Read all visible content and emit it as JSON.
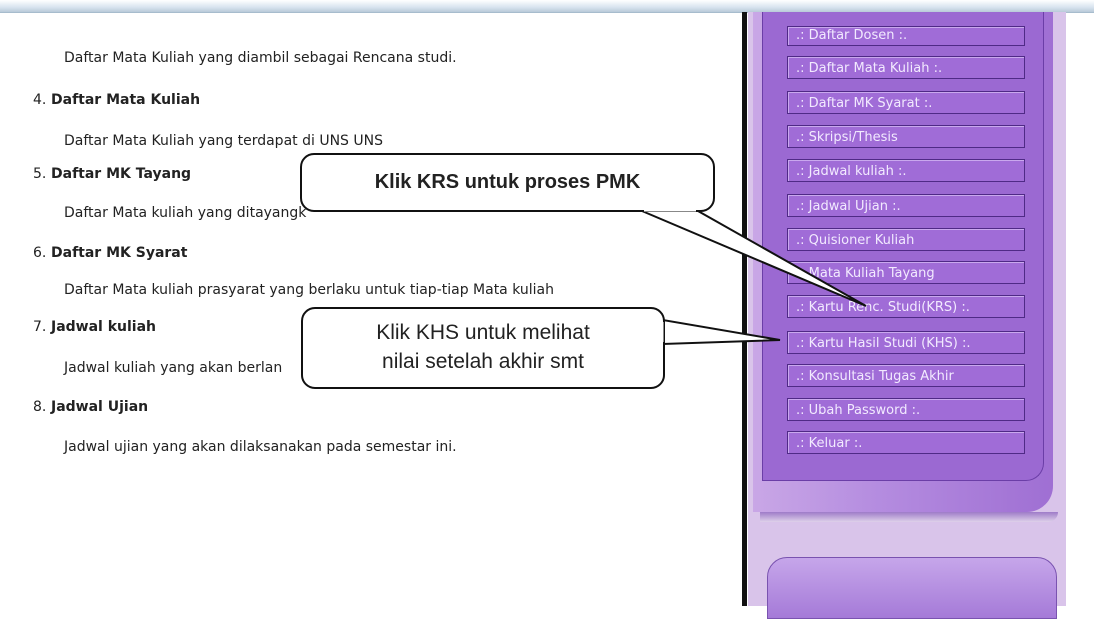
{
  "content": {
    "intro_desc": "Daftar Mata Kuliah yang diambil sebagai Rencana studi.",
    "items": [
      {
        "num": "4.",
        "title": "Daftar Mata Kuliah",
        "desc": "Daftar Mata Kuliah yang terdapat di UNS UNS"
      },
      {
        "num": "5.",
        "title": "Daftar MK Tayang",
        "desc": "Daftar Mata kuliah yang ditayangk"
      },
      {
        "num": "6.",
        "title": "Daftar MK Syarat",
        "desc": "Daftar Mata kuliah prasyarat yang berlaku untuk tiap-tiap Mata kuliah"
      },
      {
        "num": "7.",
        "title": "Jadwal kuliah",
        "desc": "Jadwal kuliah yang akan berlan"
      },
      {
        "num": "8.",
        "title": "Jadwal Ujian",
        "desc": "Jadwal ujian yang akan dilaksanakan pada semestar ini."
      }
    ]
  },
  "sidebar": {
    "menu": [
      ".: Daftar Dosen :.",
      ".: Daftar Mata Kuliah :.",
      ".: Daftar MK Syarat :.",
      ".: Skripsi/Thesis",
      ".: Jadwal kuliah :.",
      ".: Jadwal Ujian :.",
      ".: Quisioner Kuliah",
      ".: Mata Kuliah Tayang",
      ".: Kartu Renc. Studi(KRS) :.",
      ".: Kartu Hasil Studi (KHS) :.",
      ".: Konsultasi Tugas Akhir",
      ".: Ubah Password :.",
      ".: Keluar :."
    ]
  },
  "callouts": {
    "krs": "Klik KRS untuk proses PMK",
    "khs_line1": "Klik KHS untuk melihat",
    "khs_line2": "nilai  setelah akhir smt"
  }
}
